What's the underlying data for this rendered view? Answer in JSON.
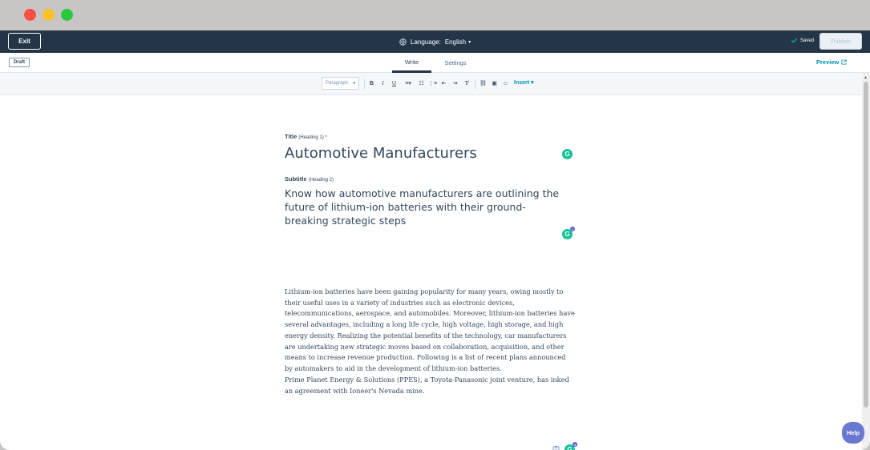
{
  "topbar": {
    "exit_label": "Exit",
    "language_label": "Language:",
    "language_value": "English",
    "saved_label": "Saved",
    "publish_label": "Publish"
  },
  "tabbar": {
    "draft_label": "Draft",
    "tabs": [
      {
        "label": "Write",
        "active": true
      },
      {
        "label": "Settings",
        "active": false
      }
    ],
    "preview_label": "Preview"
  },
  "toolbar": {
    "paragraph_select": "Paragraph",
    "insert_label": "Insert",
    "icons": [
      "bold-icon",
      "italic-icon",
      "underline-icon",
      "align-icon",
      "bullet-list-icon",
      "numbered-list-icon",
      "outdent-icon",
      "indent-icon",
      "clear-format-icon",
      "link-icon",
      "image-icon",
      "emoji-icon"
    ]
  },
  "editor": {
    "title_label": "Title",
    "title_hint": "(Heading 1) *",
    "title_value": "Automotive Manufacturers",
    "subtitle_label": "Subtitle",
    "subtitle_hint": "(Heading 2)",
    "subtitle_value": "Know how automotive manufacturers are outlining the future of lithium-ion batteries with their ground-breaking strategic steps",
    "paragraphs": [
      " Lithium-ion batteries have been gaining popularity for many years, owing mostly to their useful uses in a variety of industries such as electronic devices, telecommunications, aerospace, and automobiles. Moreover, lithium-ion batteries have several advantages, including a long life cycle, high voltage, high storage, and high energy density. Realizing the potential benefits of the technology, car manufacturers are undertaking new strategic moves based on collaboration, acquisition, and other means to increase revenue production. Following is a list of recent plans announced by automakers to aid in the development of lithium-ion batteries.",
      "Prime Planet Energy & Solutions (PPES), a Toyota-Panasonic joint venture, has inked an agreement with Ioneer's Nevada mine."
    ],
    "grammarly_badges": [
      "1",
      "3"
    ]
  },
  "help_label": "Help",
  "colors": {
    "topbar": "#243547",
    "accent": "#0091ae",
    "grammarly": "#15c39a",
    "help": "#6a78d1"
  }
}
